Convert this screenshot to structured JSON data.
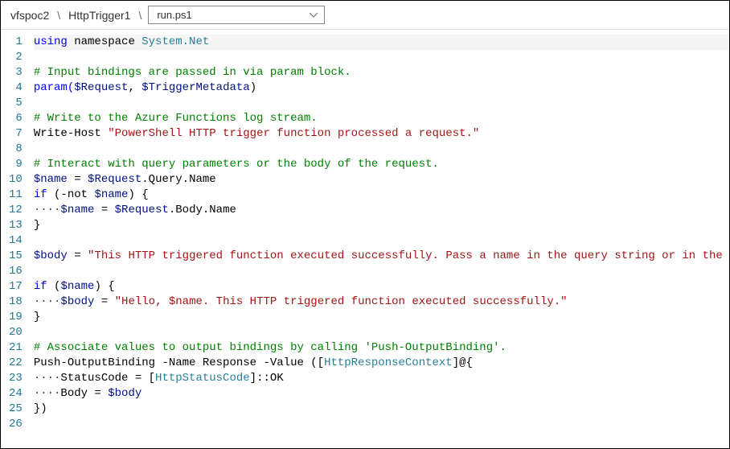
{
  "breadcrumb": {
    "item1": "vfspoc2",
    "item2": "HttpTrigger1",
    "file": "run.ps1"
  },
  "lineNumbers": [
    "1",
    "2",
    "3",
    "4",
    "5",
    "6",
    "7",
    "8",
    "9",
    "10",
    "11",
    "12",
    "13",
    "14",
    "15",
    "16",
    "17",
    "18",
    "19",
    "20",
    "21",
    "22",
    "23",
    "24",
    "25",
    "26"
  ],
  "code": {
    "l1_kw": "using",
    "l1_ns_kw": " namespace",
    "l1_ns": " System.Net",
    "l3_c": "# Input bindings are passed in via param block.",
    "l4a": "param(",
    "l4b": "$Request",
    "l4c": ", ",
    "l4d": "$TriggerMetadata",
    "l4e": ")",
    "l6_c": "# Write to the Azure Functions log stream.",
    "l7a": "Write-Host ",
    "l7b": "\"PowerShell HTTP trigger function processed a request.\"",
    "l9_c": "# Interact with query parameters or the body of the request.",
    "l10a": "$name",
    "l10b": " = ",
    "l10c": "$Request",
    "l10d": ".Query.Name",
    "l11a": "if",
    "l11b": " (-not ",
    "l11c": "$name",
    "l11d": ") {",
    "l12pad": "····",
    "l12a": "$name",
    "l12b": " = ",
    "l12c": "$Request",
    "l12d": ".Body.Name",
    "l13": "}",
    "l15a": "$body",
    "l15b": " = ",
    "l15c": "\"This HTTP triggered function executed successfully. Pass a name in the query string or in the request",
    "l17a": "if",
    "l17b": " (",
    "l17c": "$name",
    "l17d": ") {",
    "l18pad": "····",
    "l18a": "$body",
    "l18b": " = ",
    "l18c": "\"Hello, $name. This HTTP triggered function executed successfully.\"",
    "l19": "}",
    "l21_c": "# Associate values to output bindings by calling 'Push-OutputBinding'.",
    "l22a": "Push-OutputBinding -Name Response -Value ([",
    "l22b": "HttpResponseContext",
    "l22c": "]@{",
    "l23pad": "····",
    "l23a": "StatusCode = [",
    "l23b": "HttpStatusCode",
    "l23c": "]::OK",
    "l24pad": "····",
    "l24a": "Body = ",
    "l24b": "$body",
    "l25": "})"
  }
}
